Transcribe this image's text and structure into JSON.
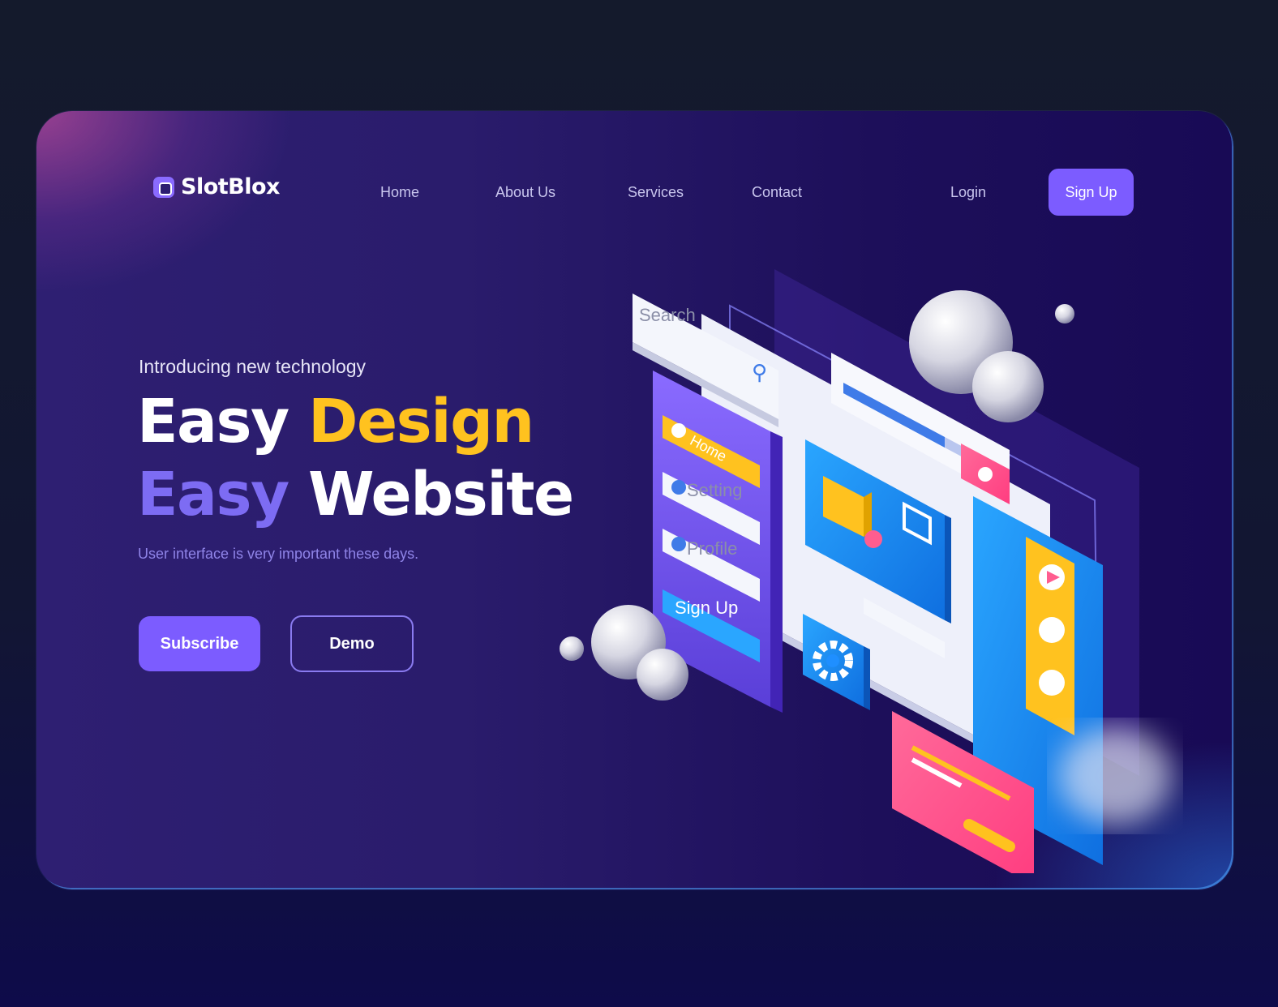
{
  "brand": {
    "name": "SlotBlox"
  },
  "nav": {
    "items": [
      {
        "label": "Home"
      },
      {
        "label": "About Us"
      },
      {
        "label": "Services"
      },
      {
        "label": "Contact"
      }
    ],
    "login_label": "Login",
    "signup_label": "Sign Up"
  },
  "hero": {
    "eyebrow": "Introducing new technology",
    "line1_word1": "Easy",
    "line1_word2": "Design",
    "line2_word1": "Easy",
    "line2_word2": "Website",
    "subtitle": "User interface is very important these days.",
    "subscribe_label": "Subscribe",
    "demo_label": "Demo"
  },
  "illustration": {
    "search_placeholder": "Search",
    "menu_items": [
      "Home",
      "Setting",
      "Profile"
    ],
    "signup_label": "Sign Up"
  },
  "colors": {
    "accent": "#7c5cff",
    "highlight_yellow": "#ffc21f",
    "highlight_purple": "#7d6cf3",
    "pink": "#ff4f8b",
    "blue": "#1f8fff"
  }
}
